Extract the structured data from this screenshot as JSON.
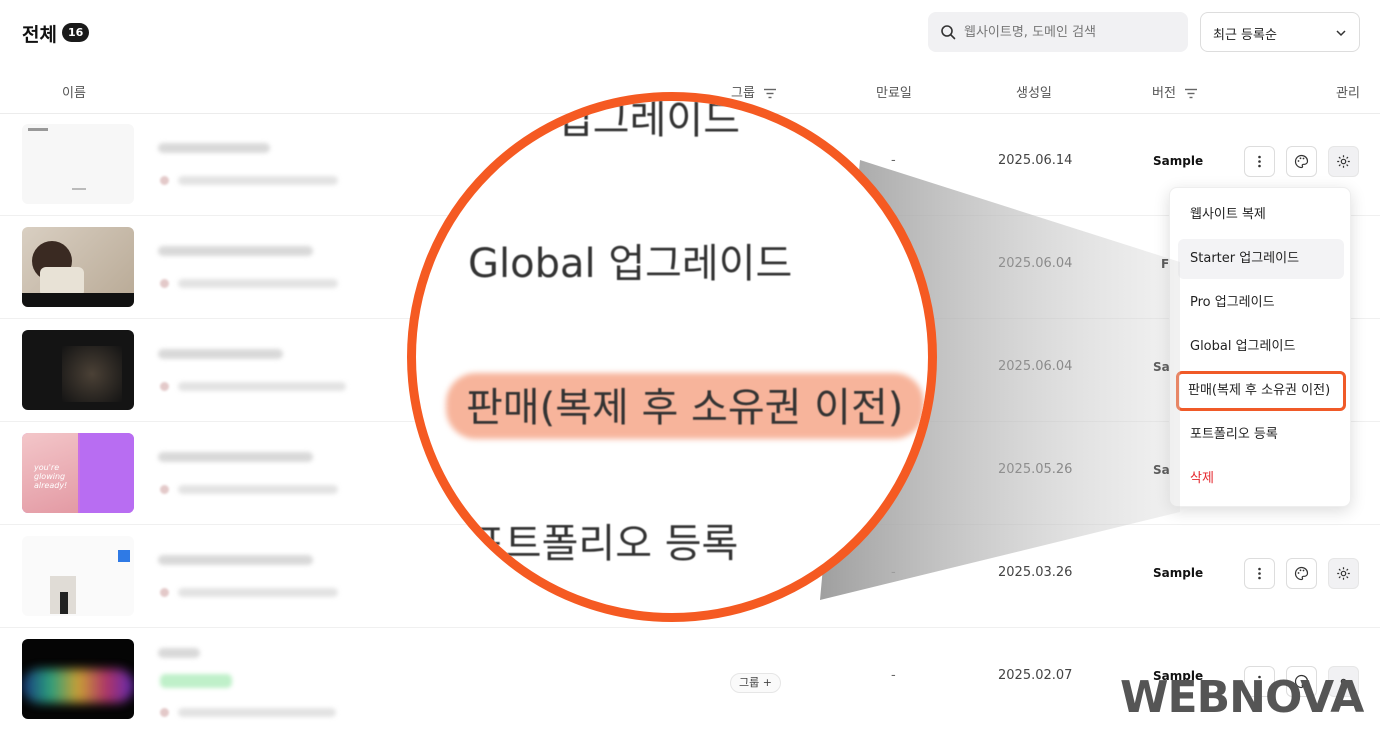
{
  "header": {
    "title": "전체",
    "count": "16",
    "search_placeholder": "웹사이트명, 도메인 검색",
    "sort_label": "최근 등록순"
  },
  "table": {
    "columns": {
      "name": "이름",
      "group": "그룹",
      "expire": "만료일",
      "created": "생성일",
      "version": "버전",
      "manage": "관리"
    },
    "rows": [
      {
        "expire": "-",
        "created": "2025.06.14",
        "version": "Sample"
      },
      {
        "expire": "",
        "created": "2025.06.04",
        "version": "F"
      },
      {
        "expire": "",
        "created": "2025.06.04",
        "version": "Sam"
      },
      {
        "expire": "",
        "created": "2025.05.26",
        "version": "Sam"
      },
      {
        "expire": "-",
        "created": "2025.03.26",
        "version": "Sample"
      },
      {
        "group_chip": "그룹 +",
        "expire": "-",
        "created": "2025.02.07",
        "version": "Sample"
      }
    ]
  },
  "menu": {
    "items": [
      "웹사이트 복제",
      "Starter 업그레이드",
      "Pro 업그레이드",
      "Global 업그레이드",
      "판매(복제 후 소유권 이전)",
      "포트폴리오 등록",
      "삭제"
    ]
  },
  "magnifier": {
    "lines": [
      "업그레이드",
      "Global 업그레이드",
      "판매(복제 후 소유권 이전)",
      "포트폴리오 등록"
    ]
  },
  "thumb_text": "you're glowing already!",
  "watermark": "WEBNOVA",
  "colors": {
    "accent": "#f55a22",
    "danger": "#e5292f",
    "highlight": "#f7b49b"
  }
}
